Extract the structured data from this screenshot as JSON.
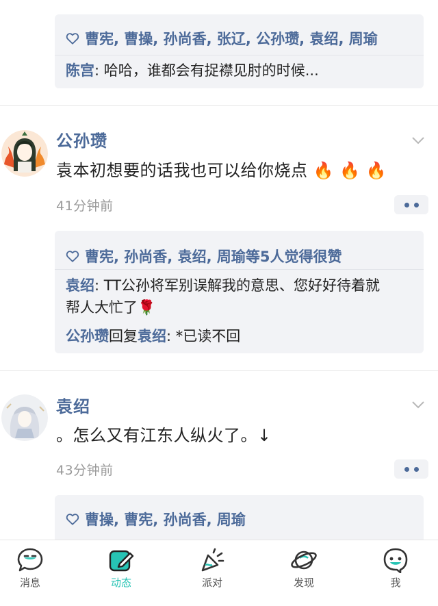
{
  "post0": {
    "likes": "曹宪, 曹操, 孙尚香, 张辽, 公孙瓒, 袁绍, 周瑜",
    "comments": [
      {
        "author": "陈宫",
        "text": ": 哈哈，谁都会有捉襟见肘的时候..."
      }
    ]
  },
  "post1": {
    "name": "公孙瓒",
    "content_l1": "袁本初想要的话我也可以给你烧点",
    "content_emoji": "🔥 🔥 🔥",
    "time": "41分钟前",
    "likes": "曹宪, 孙尚香, 袁绍, 周瑜等5人觉得很赞",
    "comments": [
      {
        "author": "袁绍",
        "text": ": TT公孙将军别误解我的意思、您好好待着就",
        "text2": "帮人大忙了",
        "emoji": "🌹"
      },
      {
        "author": "公孙瓒",
        "mid": "回复",
        "target": "袁绍",
        "text": ": *已读不回"
      }
    ]
  },
  "post2": {
    "name": "袁绍",
    "content": "。怎么又有江东人纵火了。↓",
    "time": "43分钟前",
    "likes": "曹操, 曹宪, 孙尚香, 周瑜"
  },
  "tabs": [
    {
      "label": "消息",
      "icon": "message-icon"
    },
    {
      "label": "动态",
      "icon": "moments-icon",
      "active": true
    },
    {
      "label": "派对",
      "icon": "party-icon"
    },
    {
      "label": "发现",
      "icon": "discover-planet-icon"
    },
    {
      "label": "我",
      "icon": "me-face-icon"
    }
  ],
  "colors": {
    "accent": "#27c3b4",
    "name_blue": "#4c6a99",
    "card_bg": "#f2f3f6",
    "time_gray": "#9a9a9a"
  }
}
